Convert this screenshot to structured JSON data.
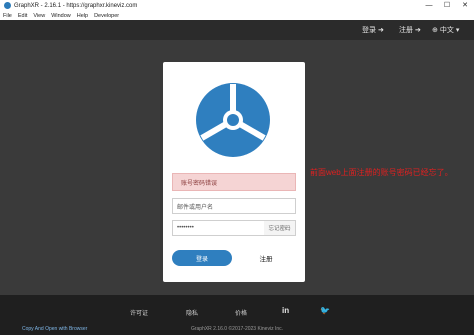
{
  "window": {
    "title": "GraphXR - 2.16.1 - https://graphxr.kineviz.com",
    "minimize": "—",
    "maximize": "☐",
    "close": "✕"
  },
  "menubar": [
    "File",
    "Edit",
    "View",
    "Window",
    "Help",
    "Developer"
  ],
  "topnav": {
    "login_label": "登录",
    "register_label": "注册",
    "language_label": "中文"
  },
  "login": {
    "error_message": "账号密码错误",
    "username_placeholder": "邮件或用户名",
    "password_value": "••••••••",
    "forgot_label": "忘记密码",
    "login_button": "登录",
    "signup_link": "注册"
  },
  "annotation": "前面web上面注册的账号密码已经忘了。",
  "footer": {
    "links": [
      "许可证",
      "隐私",
      "价格"
    ],
    "social": [
      "in",
      "🐦"
    ],
    "copyright": "GraphXR 2.16.0  ©2017-2023 Kineviz Inc.",
    "browser_link": "Copy And Open with Browser"
  },
  "colors": {
    "accent": "#2f7fbf",
    "alert_bg": "#f5d4d4",
    "annotation": "#e02020"
  }
}
